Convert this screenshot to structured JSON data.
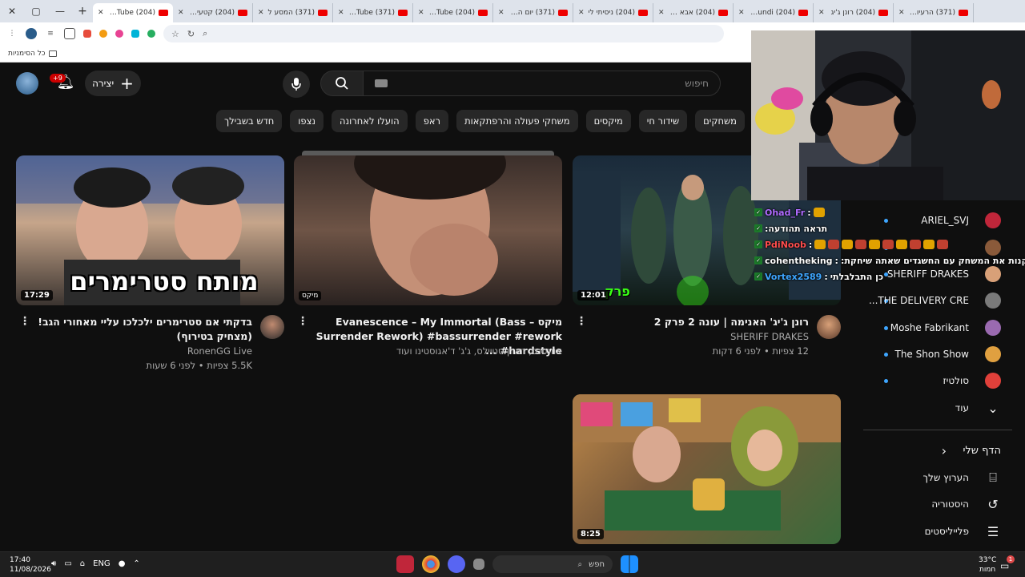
{
  "window": {
    "close": "✕",
    "restore": "▢",
    "minimize": "—",
    "new_tab": "+"
  },
  "tabs": [
    {
      "label": "(204) YouTube",
      "active": true
    },
    {
      "label": "(204) קטעים ס"
    },
    {
      "label": "(371) המסע ל"
    },
    {
      "label": "(371) YouTube"
    },
    {
      "label": "(204) YouTube"
    },
    {
      "label": "(371) יום ההור"
    },
    {
      "label": "(204) ניסיתי לי"
    },
    {
      "label": "(204) אבא קרי"
    },
    {
      "label": "(204) deFoundi"
    },
    {
      "label": "(204) רונן ג'יג"
    },
    {
      "label": "(371) הרעיון ש"
    }
  ],
  "bookmarks_bar": {
    "all_bookmarks": "כל הסימניות"
  },
  "header": {
    "notifications_badge": "+9",
    "create_label": "יצירה",
    "search_placeholder": "חיפוש"
  },
  "chips": [
    "משחקים",
    "שידור חי",
    "מיקסים",
    "משחקי פעולה והרפתקאות",
    "ראפ",
    "הועלו לאחרונה",
    "נצפו",
    "חדש בשבילך"
  ],
  "videos": [
    {
      "title": "בדקתי אם סטרימרים ילכלכו עליי מאחורי הגב! (מצחיק בטירוף)",
      "channel": "RonenGG Live",
      "stats": "5.5K צפיות • לפני 6 שעות",
      "duration": "17:29",
      "overlay_text": "מותח סטרימרים"
    },
    {
      "title": "מיקס – Evanescence – My Immortal (Bass Surrender Rework) #bassurrender #rework #hardstyle ...",
      "channel": "אוונסנס, דארן סטיילס, ג'ג' ד'אגוסטינו ועוד",
      "stats": "",
      "duration": "מיקס"
    },
    {
      "title": "רונן ג'יג' האנימה | עונה 2 פרק 2",
      "channel": "SHERIFF DRAKES",
      "stats": "12 צפיות • לפני 6 דקות",
      "duration": "12:01",
      "overlay_text": "פרק"
    },
    {
      "title": "",
      "channel": "",
      "stats": "",
      "duration": "8:25"
    }
  ],
  "sidebar": {
    "subscriptions": [
      {
        "label": "ARIEL_SVJ"
      },
      {
        "label": ""
      },
      {
        "label": "SHERIFF DRAKES"
      },
      {
        "label": "THE DELIVERY CRE..."
      },
      {
        "label": "Moshe Fabrikant"
      },
      {
        "label": "The Shon Show"
      },
      {
        "label": "סולטיז"
      }
    ],
    "more": "עוד",
    "my_page": "הדף שלי",
    "my_channel": "הערוץ שלך",
    "history": "היסטוריה",
    "playlists": "פלייליסטים"
  },
  "chat": [
    {
      "user": "Ohad_Fr",
      "message": "",
      "color": "#b06bff"
    },
    {
      "user": "",
      "message": "תראה תהודעה:",
      "color": "#ffffff"
    },
    {
      "user": "PdiNoob",
      "message": "",
      "color": "#ff4d4d"
    },
    {
      "user": "cohentheking",
      "message": "ממליץ לקנות את המשחק עם החשגדים שאתה שיחקת:",
      "color": "#ffffff"
    },
    {
      "user": "Vortex2589",
      "message": "כן התבלבלתי",
      "color": "#3ea6ff"
    }
  ],
  "taskbar": {
    "time": "17:40",
    "date": "11/08/2026",
    "lang": "ENG",
    "search": "חפש",
    "temp": "33°C",
    "weather": "חמות",
    "notif_count": "1"
  }
}
